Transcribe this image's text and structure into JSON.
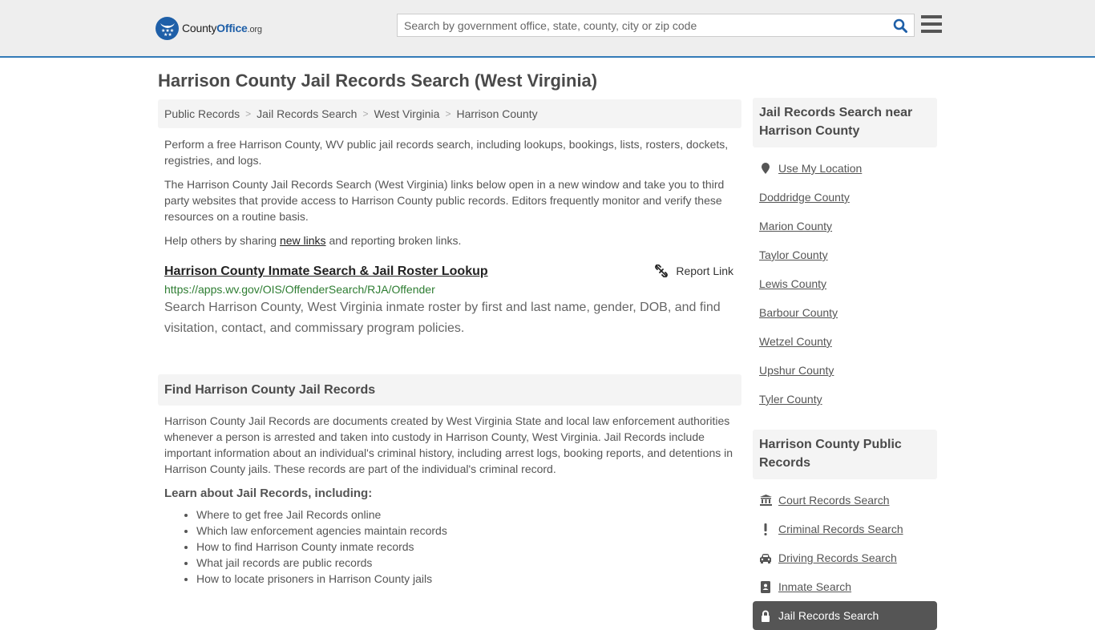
{
  "header": {
    "logo_county": "County",
    "logo_office": "Office",
    "logo_org": ".org",
    "search_placeholder": "Search by government office, state, county, city or zip code",
    "search_icon": "search-icon",
    "menu_icon": "hamburger-menu-icon"
  },
  "page": {
    "title": "Harrison County Jail Records Search (West Virginia)"
  },
  "breadcrumb": [
    {
      "label": "Public Records"
    },
    {
      "label": "Jail Records Search"
    },
    {
      "label": "West Virginia"
    },
    {
      "label": "Harrison County"
    }
  ],
  "intro": {
    "p1": "Perform a free Harrison County, WV public jail records search, including lookups, bookings, lists, rosters, dockets, registries, and logs.",
    "p2": "The Harrison County Jail Records Search (West Virginia) links below open in a new window and take you to third party websites that provide access to Harrison County public records. Editors frequently monitor and verify these resources on a routine basis.",
    "p3_before": "Help others by sharing ",
    "p3_link": "new links",
    "p3_after": " and reporting broken links."
  },
  "links": [
    {
      "title": "Harrison County Inmate Search & Jail Roster Lookup",
      "url": "https://apps.wv.gov/OIS/OffenderSearch/RJA/Offender",
      "description": "Search Harrison County, West Virginia inmate roster by first and last name, gender, DOB, and find visitation, contact, and commissary program policies.",
      "report_label": "Report Link",
      "report_icon": "broken-link-icon"
    }
  ],
  "find_section": {
    "heading": "Find Harrison County Jail Records",
    "body": "Harrison County Jail Records are documents created by West Virginia State and local law enforcement authorities whenever a person is arrested and taken into custody in Harrison County, West Virginia. Jail Records include important information about an individual's criminal history, including arrest logs, booking reports, and detentions in Harrison County jails. These records are part of the individual's criminal record.",
    "subheading": "Learn about Jail Records, including:",
    "items": [
      "Where to get free Jail Records online",
      "Which law enforcement agencies maintain records",
      "How to find Harrison County inmate records",
      "What jail records are public records",
      "How to locate prisoners in Harrison County jails"
    ]
  },
  "sidebar": {
    "nearby": {
      "heading": "Jail Records Search near Harrison County",
      "use_location": "Use My Location",
      "counties": [
        "Doddridge County",
        "Marion County",
        "Taylor County",
        "Lewis County",
        "Barbour County",
        "Wetzel County",
        "Upshur County",
        "Tyler County"
      ]
    },
    "public_records": {
      "heading": "Harrison County Public Records",
      "items": [
        {
          "label": "Court Records Search",
          "icon": "courthouse-icon"
        },
        {
          "label": "Criminal Records Search",
          "icon": "exclamation-icon"
        },
        {
          "label": "Driving Records Search",
          "icon": "car-icon"
        },
        {
          "label": "Inmate Search",
          "icon": "id-badge-icon"
        }
      ],
      "active": {
        "label": "Jail Records Search",
        "icon": "lock-icon"
      }
    }
  }
}
